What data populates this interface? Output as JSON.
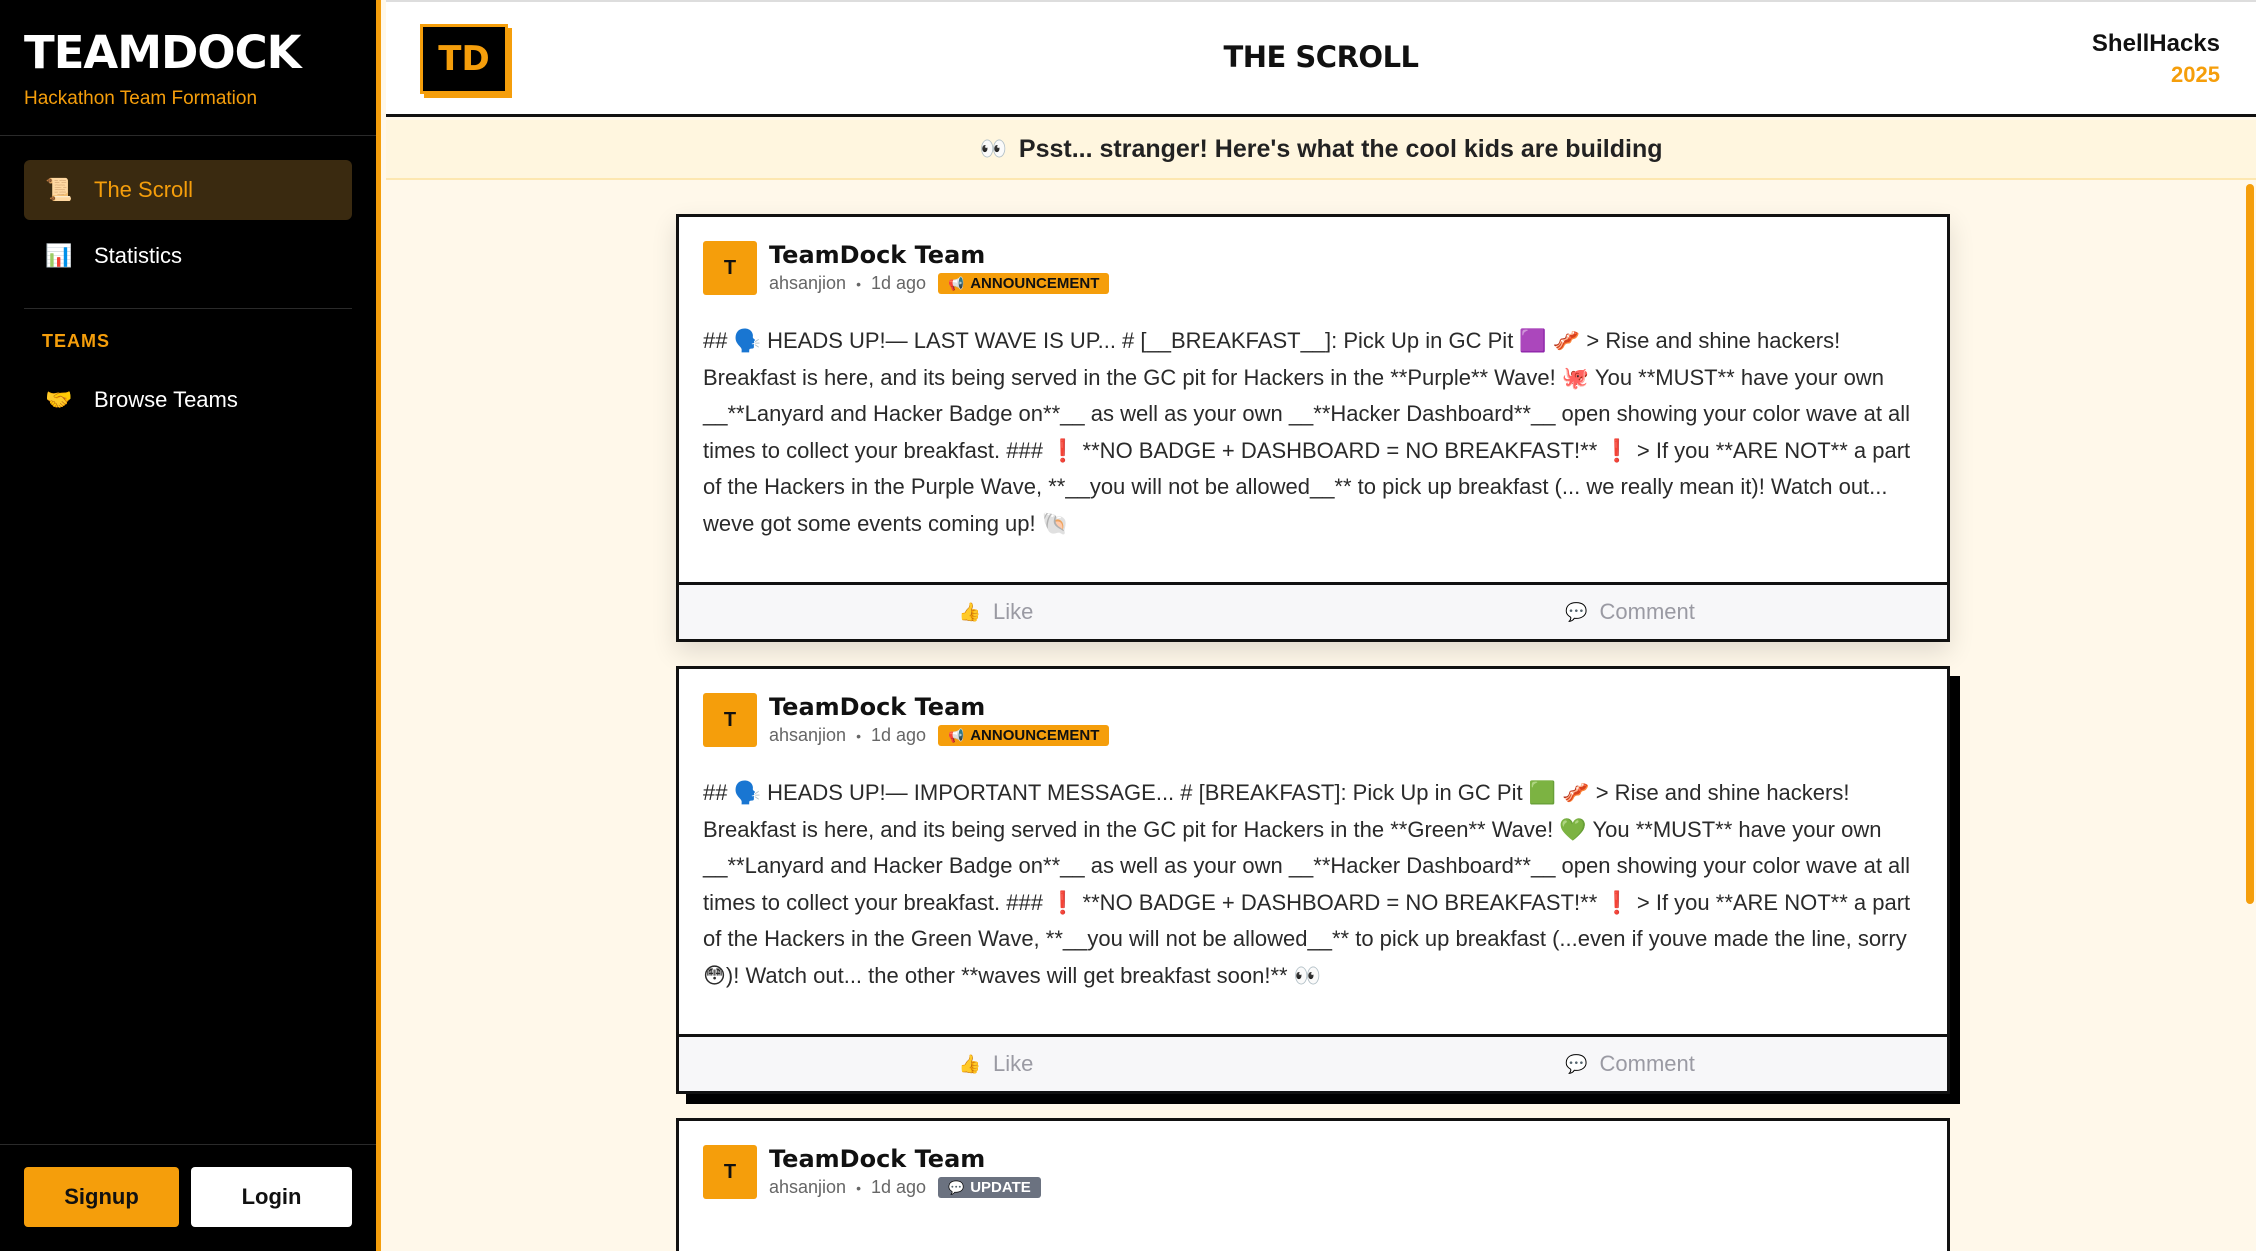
{
  "sidebar": {
    "brand_title": "TEAMDOCK",
    "brand_subtitle": "Hackathon Team Formation",
    "nav": [
      {
        "label": "The Scroll",
        "icon": "scroll-icon",
        "glyph": "📜",
        "active": true
      },
      {
        "label": "Statistics",
        "icon": "bar-chart-icon",
        "glyph": "📊",
        "active": false
      }
    ],
    "teams_heading": "TEAMS",
    "teams_nav": [
      {
        "label": "Browse Teams",
        "icon": "handshake-icon",
        "glyph": "🤝"
      }
    ],
    "signup_label": "Signup",
    "login_label": "Login"
  },
  "header": {
    "logo": "TD",
    "title": "THE SCROLL",
    "event_name": "ShellHacks",
    "event_year": "2025"
  },
  "banner": {
    "icon": "eyes-icon",
    "glyph": "👀",
    "text": "Psst... stranger! Here's what the cool kids are building"
  },
  "posts": [
    {
      "avatar": "T",
      "author": "TeamDock Team",
      "username": "ahsanjion",
      "time": "1d ago",
      "tag": "ANNOUNCEMENT",
      "tag_glyph": "📢",
      "body": "## 🗣️ HEADS UP!— LAST WAVE IS UP... # [__BREAKFAST__]: Pick Up in GC Pit 🟪 🥓 > Rise and shine hackers! Breakfast is here, and its being served in the GC pit for Hackers in the **Purple** Wave! 🐙 You **MUST** have your own __**Lanyard and Hacker Badge on**__ as well as your own __**Hacker Dashboard**__ open showing your color wave at all times to collect your breakfast. ### ❗ **NO BADGE + DASHBOARD = NO BREAKFAST!** ❗ > If you **ARE NOT** a part of the Hackers in the Purple Wave, **__you will not be allowed__** to pick up breakfast (... we really mean it)! Watch out... weve got some events coming up! 🐚",
      "like_label": "Like",
      "comment_label": "Comment"
    },
    {
      "avatar": "T",
      "author": "TeamDock Team",
      "username": "ahsanjion",
      "time": "1d ago",
      "tag": "ANNOUNCEMENT",
      "tag_glyph": "📢",
      "body": "## 🗣️ HEADS UP!— IMPORTANT MESSAGE... # [BREAKFAST]: Pick Up in GC Pit 🟩 🥓 > Rise and shine hackers! Breakfast is here, and its being served in the GC pit for Hackers in the **Green** Wave! 💚 You **MUST** have your own __**Lanyard and Hacker Badge on**__ as well as your own __**Hacker Dashboard**__ open showing your color wave at all times to collect your breakfast. ### ❗ **NO BADGE + DASHBOARD = NO BREAKFAST!** ❗ > If you **ARE NOT** a part of the Hackers in the Green Wave, **__you will not be allowed__** to pick up breakfast (...even if youve made the line, sorry 😳)! Watch out... the other **waves will get breakfast soon!** 👀",
      "like_label": "Like",
      "comment_label": "Comment"
    },
    {
      "avatar": "T",
      "author": "TeamDock Team",
      "username": "ahsanjion",
      "time": "1d ago",
      "tag": "UPDATE",
      "tag_glyph": "💬",
      "body": "",
      "like_label": "Like",
      "comment_label": "Comment"
    }
  ],
  "action_icons": {
    "like": "thumbs-up-icon",
    "comment": "speech-bubble-icon",
    "like_glyph": "👍",
    "comment_glyph": "💬"
  },
  "colors": {
    "accent": "#f59e0b",
    "sidebar_bg": "#000000",
    "page_bg": "#fff8ea"
  }
}
